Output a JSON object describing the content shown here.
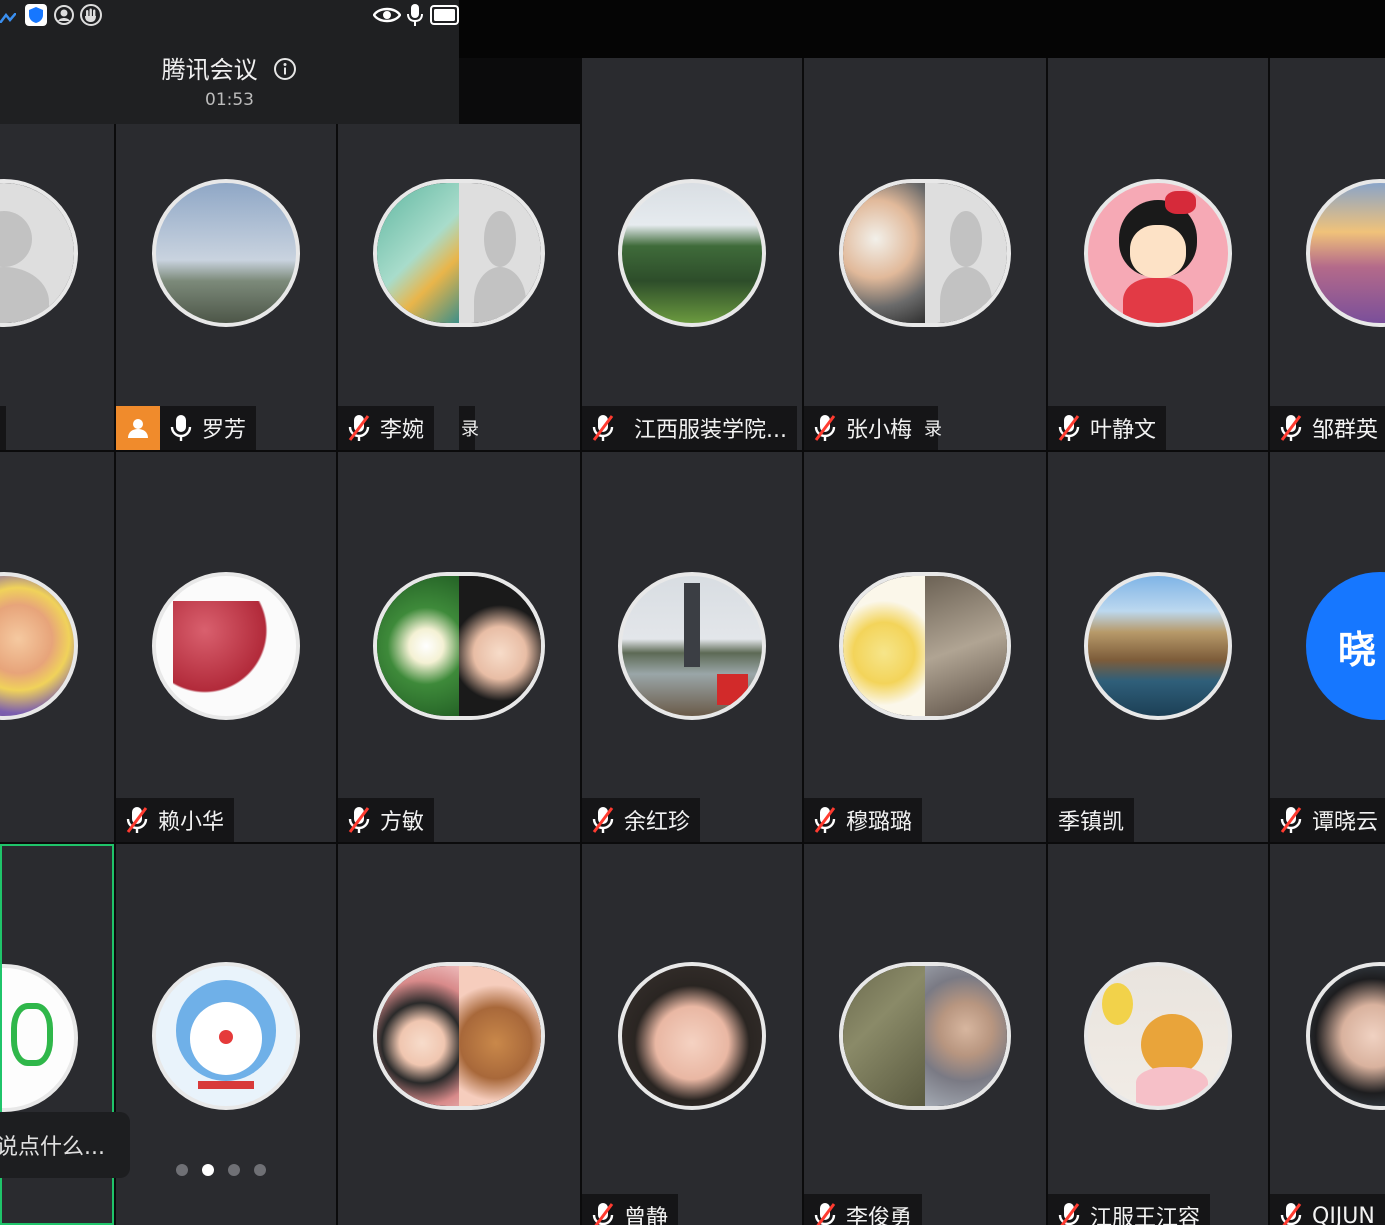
{
  "meeting": {
    "title": "腾讯会议",
    "time": "01:53"
  },
  "status_icons": [
    "signal-icon",
    "shield-icon",
    "user-circle-icon",
    "hand-icon",
    "eye-icon",
    "mic-icon",
    "battery-icon"
  ],
  "row1": [
    {
      "name": "",
      "muted": true
    },
    {
      "name": "罗芳",
      "muted": false,
      "host": true
    },
    {
      "name": "李婉",
      "muted": true,
      "extra": "录"
    },
    {
      "name": "江西服装学院...",
      "muted": true
    },
    {
      "name": "张小梅",
      "muted": true,
      "extra": "录"
    },
    {
      "name": "叶静文",
      "muted": true
    },
    {
      "name": "邹群英",
      "muted": true
    }
  ],
  "row2": [
    {
      "name": "",
      "muted": true
    },
    {
      "name": "赖小华",
      "muted": true
    },
    {
      "name": "方敏",
      "muted": true
    },
    {
      "name": "余红珍",
      "muted": true
    },
    {
      "name": "穆璐璐",
      "muted": true
    },
    {
      "name": "季镇凯",
      "muted": false,
      "nomic": true
    },
    {
      "name": "谭晓云",
      "muted": true,
      "avatar_text": "晓"
    }
  ],
  "row3": [
    {
      "name": "",
      "muted": true
    },
    {
      "name": "",
      "muted": true
    },
    {
      "name": "",
      "muted": true
    },
    {
      "name": "曾静",
      "muted": true
    },
    {
      "name": "李俊勇",
      "muted": true
    },
    {
      "name": "江服王江容",
      "muted": true
    },
    {
      "name": "QIJUN",
      "muted": true
    }
  ],
  "chat_placeholder": "说点什么...",
  "pager": {
    "count": 4,
    "active": 1
  },
  "colors": {
    "tile": "#2a2b2f",
    "host_badge": "#f08b2c",
    "active_border": "#1fc46a",
    "mute_red": "#ff3b30",
    "avatar_blue": "#1677ff"
  }
}
